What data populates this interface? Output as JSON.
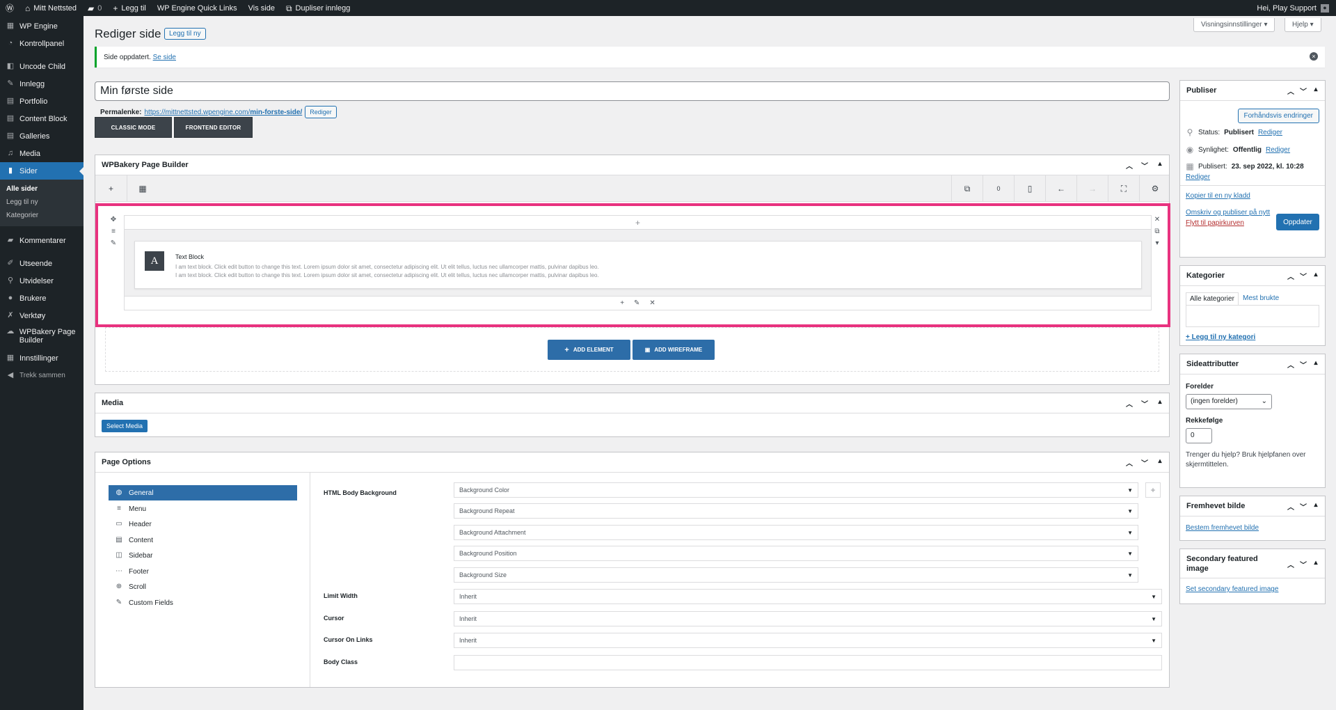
{
  "adminbar": {
    "site_name": "Mitt Nettsted",
    "comments_count": "0",
    "add_new": "Legg til",
    "quick_links": "WP Engine Quick Links",
    "view_page": "Vis side",
    "duplicate": "Dupliser innlegg",
    "greeting": "Hei, Play Support"
  },
  "menu": {
    "items": [
      {
        "label": "WP Engine",
        "icon": "wpengine-icon"
      },
      {
        "label": "Kontrollpanel",
        "icon": "dashboard-icon"
      },
      {
        "label": "Uncode Child",
        "icon": "uncode-icon"
      },
      {
        "label": "Innlegg",
        "icon": "pin-icon"
      },
      {
        "label": "Portfolio",
        "icon": "portfolio-icon"
      },
      {
        "label": "Content Block",
        "icon": "content-block-icon"
      },
      {
        "label": "Galleries",
        "icon": "galleries-icon"
      },
      {
        "label": "Media",
        "icon": "media-icon"
      },
      {
        "label": "Sider",
        "icon": "pages-icon"
      },
      {
        "label": "Kommentarer",
        "icon": "comment-icon"
      },
      {
        "label": "Utseende",
        "icon": "brush-icon"
      },
      {
        "label": "Utvidelser",
        "icon": "plugin-icon"
      },
      {
        "label": "Brukere",
        "icon": "user-icon"
      },
      {
        "label": "Verktøy",
        "icon": "wrench-icon"
      },
      {
        "label": "WPBakery Page Builder",
        "icon": "wpbakery-icon"
      },
      {
        "label": "Innstillinger",
        "icon": "settings-icon"
      },
      {
        "label": "Trekk sammen",
        "icon": "collapse-icon"
      }
    ],
    "submenu": [
      "Alle sider",
      "Legg til ny",
      "Kategorier"
    ]
  },
  "header": {
    "screen_options": "Visningsinnstillinger",
    "help": "Hjelp",
    "title": "Rediger side",
    "add_new": "Legg til ny"
  },
  "notice": {
    "text": "Side oppdatert.",
    "link": "Se side"
  },
  "post": {
    "title": "Min første side",
    "permalink_label": "Permalenke:",
    "permalink_base": "https://mittnettsted.wpengine.com/",
    "permalink_slug": "min-forste-side/",
    "permalink_edit": "Rediger"
  },
  "modes": {
    "classic": "CLASSIC MODE",
    "frontend": "FRONTEND EDITOR"
  },
  "wpbakery": {
    "title": "WPBakery Page Builder",
    "undo_count": "0",
    "element_title": "Text Block",
    "element_text_1": "I am text block. Click edit button to change this text. Lorem ipsum dolor sit amet, consectetur adipiscing elit. Ut elit tellus, luctus nec ullamcorper mattis, pulvinar dapibus leo.",
    "element_text_2": "I am text block. Click edit button to change this text. Lorem ipsum dolor sit amet, consectetur adipiscing elit. Ut elit tellus, luctus nec ullamcorper mattis, pulvinar dapibus leo.",
    "add_element": "ADD ELEMENT",
    "add_wireframe": "ADD WIREFRAME"
  },
  "media_box": {
    "title": "Media",
    "button": "Select Media"
  },
  "page_options": {
    "title": "Page Options",
    "nav": [
      "General",
      "Menu",
      "Header",
      "Content",
      "Sidebar",
      "Footer",
      "Scroll",
      "Custom Fields"
    ],
    "html_body_background": "HTML Body Background",
    "bg_selects": [
      "Background Color",
      "Background Repeat",
      "Background Attachment",
      "Background Position",
      "Background Size"
    ],
    "limit_width_label": "Limit Width",
    "limit_width_value": "Inherit",
    "cursor_label": "Cursor",
    "cursor_value": "Inherit",
    "cursor_links_label": "Cursor On Links",
    "cursor_links_value": "Inherit",
    "body_class_label": "Body Class"
  },
  "publish": {
    "title": "Publiser",
    "preview": "Forhåndsvis endringer",
    "status_label": "Status:",
    "status_value": "Publisert",
    "visibility_label": "Synlighet:",
    "visibility_value": "Offentlig",
    "published_label": "Publisert:",
    "published_value": "23. sep 2022, kl. 10:28",
    "edit": "Rediger",
    "copy_draft": "Kopier til en ny kladd",
    "rewrite": "Omskriv og publiser på nytt",
    "trash": "Flytt til papirkurven",
    "update": "Oppdater"
  },
  "categories": {
    "title": "Kategorier",
    "tab_all": "Alle kategorier",
    "tab_most": "Mest brukte",
    "add_new": "+ Legg til ny kategori"
  },
  "page_attributes": {
    "title": "Sideattributter",
    "parent_label": "Forelder",
    "parent_value": "(ingen forelder)",
    "order_label": "Rekkefølge",
    "order_value": "0",
    "help": "Trenger du hjelp? Bruk hjelpfanen over skjermtittelen."
  },
  "featured": {
    "title": "Fremhevet bilde",
    "link": "Bestem fremhevet bilde"
  },
  "secondary_featured": {
    "title": "Secondary featured image",
    "link": "Set secondary featured image"
  }
}
